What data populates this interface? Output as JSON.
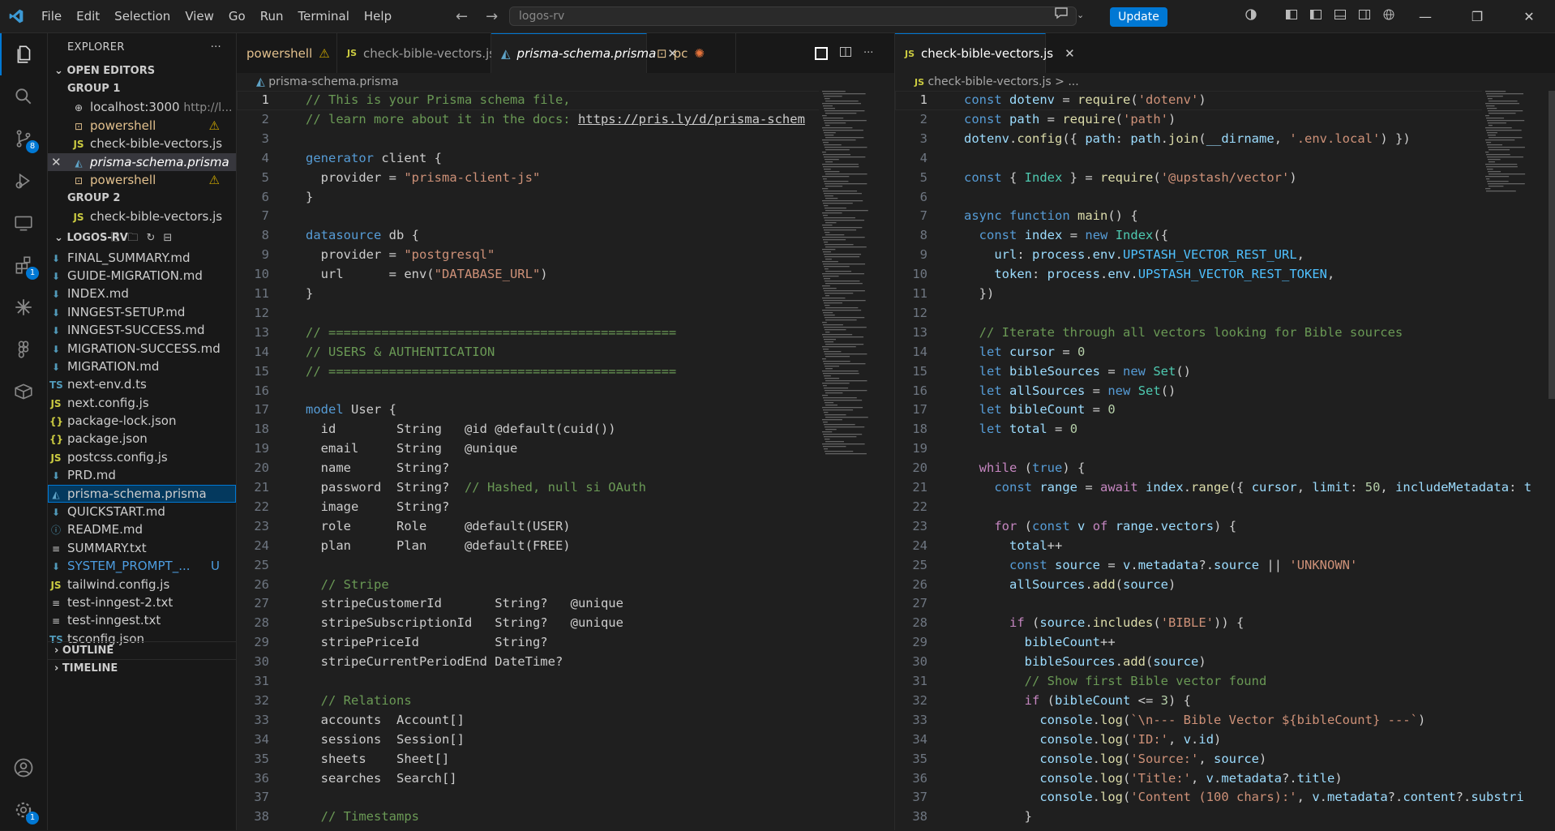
{
  "menu": [
    "File",
    "Edit",
    "Selection",
    "View",
    "Go",
    "Run",
    "Terminal",
    "Help"
  ],
  "search_text": "logos-rv",
  "update_label": "Update",
  "sidebar": {
    "title": "EXPLORER",
    "open_editors": "OPEN EDITORS",
    "group1": "GROUP 1",
    "group2": "GROUP 2",
    "g1": [
      {
        "icon": "globe",
        "name": "localhost:3000",
        "extra": "http://l..."
      },
      {
        "icon": "terminal",
        "name": "powershell",
        "warn": true
      },
      {
        "icon": "js",
        "name": "check-bible-vectors.js"
      },
      {
        "icon": "prisma",
        "name": "prisma-schema.prisma",
        "active": true
      },
      {
        "icon": "terminal",
        "name": "powershell",
        "warn": true
      }
    ],
    "g2": [
      {
        "icon": "js",
        "name": "check-bible-vectors.js"
      }
    ],
    "project": "LOGOS-RV",
    "files": [
      {
        "icon": "md",
        "name": "FINAL_SUMMARY.md"
      },
      {
        "icon": "md",
        "name": "GUIDE-MIGRATION.md"
      },
      {
        "icon": "md",
        "name": "INDEX.md"
      },
      {
        "icon": "md",
        "name": "INNGEST-SETUP.md"
      },
      {
        "icon": "md",
        "name": "INNGEST-SUCCESS.md"
      },
      {
        "icon": "md",
        "name": "MIGRATION-SUCCESS.md"
      },
      {
        "icon": "md",
        "name": "MIGRATION.md"
      },
      {
        "icon": "ts",
        "name": "next-env.d.ts"
      },
      {
        "icon": "js",
        "name": "next.config.js"
      },
      {
        "icon": "json",
        "name": "package-lock.json"
      },
      {
        "icon": "json",
        "name": "package.json"
      },
      {
        "icon": "js",
        "name": "postcss.config.js"
      },
      {
        "icon": "md",
        "name": "PRD.md"
      },
      {
        "icon": "prisma",
        "name": "prisma-schema.prisma",
        "focus": true
      },
      {
        "icon": "md",
        "name": "QUICKSTART.md"
      },
      {
        "icon": "info",
        "name": "README.md"
      },
      {
        "icon": "txt",
        "name": "SUMMARY.txt"
      },
      {
        "icon": "md",
        "name": "SYSTEM_PROMPT_...",
        "status": "U"
      },
      {
        "icon": "js",
        "name": "tailwind.config.js"
      },
      {
        "icon": "txt",
        "name": "test-inngest-2.txt"
      },
      {
        "icon": "txt",
        "name": "test-inngest.txt"
      },
      {
        "icon": "ts",
        "name": "tsconfig.json"
      }
    ],
    "outline": "OUTLINE",
    "timeline": "TIMELINE"
  },
  "badges": {
    "scm": "8",
    "extensions": "1",
    "settings": "1"
  },
  "left_tabs": [
    {
      "icon": "terminal",
      "label": "powershell",
      "warn": true
    },
    {
      "icon": "js",
      "label": "check-bible-vectors.js"
    },
    {
      "icon": "prisma",
      "label": "prisma-schema.prisma",
      "active": true
    },
    {
      "icon": "terminal",
      "label": "pc"
    }
  ],
  "right_tabs": [
    {
      "icon": "js",
      "label": "check-bible-vectors.js",
      "active": true
    }
  ],
  "left_breadcrumb": "prisma-schema.prisma",
  "right_breadcrumb": "check-bible-vectors.js > ...",
  "left_code": [
    "// This is your Prisma schema file,",
    "// learn more about it in the docs: https://pris.ly/d/prisma-schem",
    "",
    "generator client {",
    "  provider = \"prisma-client-js\"",
    "}",
    "",
    "datasource db {",
    "  provider = \"postgresql\"",
    "  url      = env(\"DATABASE_URL\")",
    "}",
    "",
    "// ==============================================",
    "// USERS & AUTHENTICATION",
    "// ==============================================",
    "",
    "model User {",
    "  id        String   @id @default(cuid())",
    "  email     String   @unique",
    "  name      String?",
    "  password  String?  // Hashed, null si OAuth",
    "  image     String?",
    "  role      Role     @default(USER)",
    "  plan      Plan     @default(FREE)",
    "",
    "  // Stripe",
    "  stripeCustomerId       String?   @unique",
    "  stripeSubscriptionId   String?   @unique",
    "  stripePriceId          String?",
    "  stripeCurrentPeriodEnd DateTime?",
    "",
    "  // Relations",
    "  accounts  Account[]",
    "  sessions  Session[]",
    "  sheets    Sheet[]",
    "  searches  Search[]",
    "",
    "  // Timestamps"
  ],
  "right_code": [
    "const dotenv = require('dotenv')",
    "const path = require('path')",
    "dotenv.config({ path: path.join(__dirname, '.env.local') })",
    "",
    "const { Index } = require('@upstash/vector')",
    "",
    "async function main() {",
    "  const index = new Index({",
    "    url: process.env.UPSTASH_VECTOR_REST_URL,",
    "    token: process.env.UPSTASH_VECTOR_REST_TOKEN,",
    "  })",
    "",
    "  // Iterate through all vectors looking for Bible sources",
    "  let cursor = 0",
    "  let bibleSources = new Set()",
    "  let allSources = new Set()",
    "  let bibleCount = 0",
    "  let total = 0",
    "",
    "  while (true) {",
    "    const range = await index.range({ cursor, limit: 50, includeMetadata: t",
    "",
    "    for (const v of range.vectors) {",
    "      total++",
    "      const source = v.metadata?.source || 'UNKNOWN'",
    "      allSources.add(source)",
    "",
    "      if (source.includes('BIBLE')) {",
    "        bibleCount++",
    "        bibleSources.add(source)",
    "        // Show first Bible vector found",
    "        if (bibleCount <= 3) {",
    "          console.log(`\\n--- Bible Vector ${bibleCount} ---`)",
    "          console.log('ID:', v.id)",
    "          console.log('Source:', source)",
    "          console.log('Title:', v.metadata?.title)",
    "          console.log('Content (100 chars):', v.metadata?.content?.substri",
    "        }"
  ],
  "colors": {
    "accent": "#0078d4",
    "bg": "#1f1f1f",
    "sidebar": "#181818"
  }
}
